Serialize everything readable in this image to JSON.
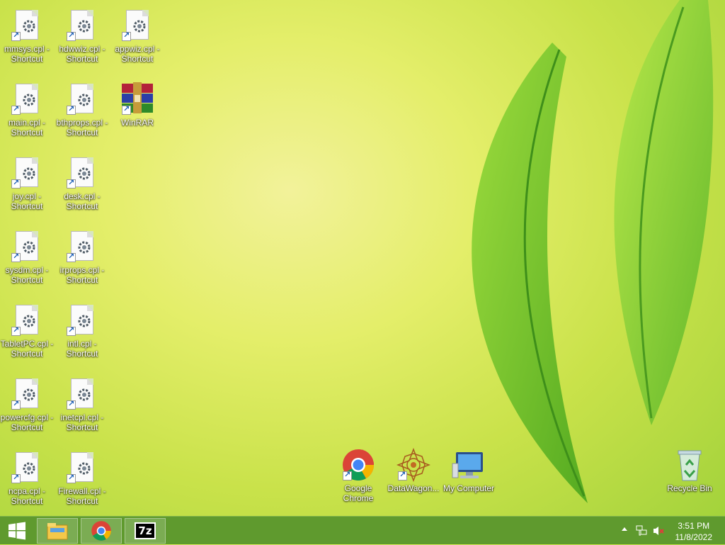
{
  "desktop": {
    "icons": [
      {
        "label": "mmsys.cpl - Shortcut"
      },
      {
        "label": "hdwwiz.cpl - Shortcut"
      },
      {
        "label": "appwiz.cpl - Shortcut"
      },
      {
        "label": "main.cpl - Shortcut"
      },
      {
        "label": "bthprops.cpl - Shortcut"
      },
      {
        "label": "WinRAR"
      },
      {
        "label": "joy.cpl - Shortcut"
      },
      {
        "label": "desk.cpl - Shortcut"
      },
      {
        "label": "sysdm.cpl - Shortcut"
      },
      {
        "label": "irprops.cpl - Shortcut"
      },
      {
        "label": "TabletPC.cpl - Shortcut"
      },
      {
        "label": "intl.cpl - Shortcut"
      },
      {
        "label": "powercfg.cpl - Shortcut"
      },
      {
        "label": "inetcpl.cpl - Shortcut"
      },
      {
        "label": "ncpa.cpl - Shortcut"
      },
      {
        "label": "Firewall.cpl - Shortcut"
      },
      {
        "label": "Google Chrome"
      },
      {
        "label": "DataWagon..."
      },
      {
        "label": "My Computer"
      },
      {
        "label": "Recycle Bin"
      }
    ]
  },
  "taskbar": {
    "apps": [
      "File Explorer",
      "Google Chrome",
      "7-Zip"
    ],
    "seven_zip_text": "7z",
    "tray": {
      "clock_time": "3:51 PM",
      "clock_date": "11/8/2022"
    }
  },
  "colors": {
    "taskbar": "#5f9a2e",
    "accent": "#7db24b"
  }
}
